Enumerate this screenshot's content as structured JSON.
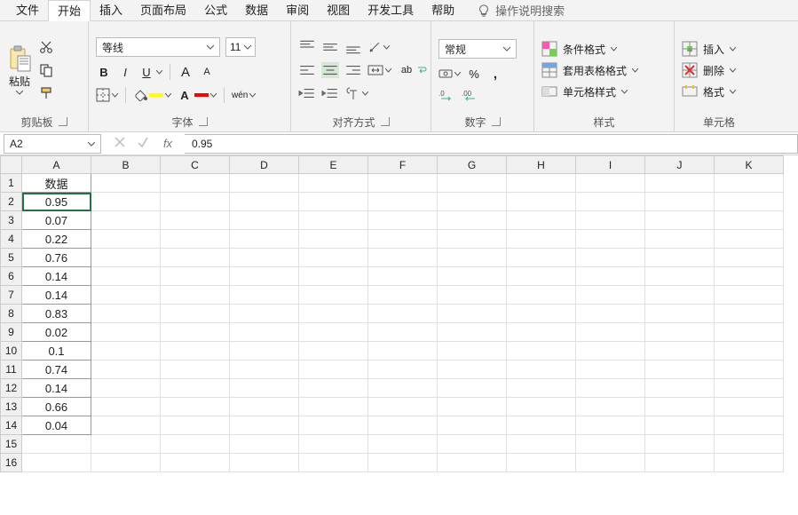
{
  "tabs": {
    "items": [
      "文件",
      "开始",
      "插入",
      "页面布局",
      "公式",
      "数据",
      "审阅",
      "视图",
      "开发工具",
      "帮助"
    ],
    "active_index": 1,
    "tell_me": "操作说明搜索"
  },
  "ribbon": {
    "clipboard": {
      "paste_label": "粘贴",
      "group_label": "剪贴板"
    },
    "font": {
      "name": "等线",
      "size": "11",
      "bold": "B",
      "italic": "I",
      "underline": "U",
      "increase": "A",
      "decrease": "A",
      "phonetic": "wén",
      "fontcolor": "A",
      "group_label": "字体"
    },
    "alignment": {
      "wrap": "ab",
      "group_label": "对齐方式"
    },
    "number": {
      "format": "常规",
      "percent": "%",
      "comma": ",",
      "dec_inc": ".0",
      "dec_dec": ".00",
      "group_label": "数字"
    },
    "styles": {
      "conditional": "条件格式",
      "table": "套用表格格式",
      "cellstyles": "单元格样式",
      "group_label": "样式"
    },
    "cells": {
      "insert": "插入",
      "delete": "删除",
      "format": "格式",
      "group_label": "单元格"
    }
  },
  "formula_bar": {
    "name_box": "A2",
    "fx": "fx",
    "value": "0.95"
  },
  "grid": {
    "columns": [
      "A",
      "B",
      "C",
      "D",
      "E",
      "F",
      "G",
      "H",
      "I",
      "J",
      "K"
    ],
    "row_count": 16,
    "selected_cell": "A2",
    "columnA": {
      "header": "数据",
      "values": [
        "0.95",
        "0.07",
        "0.22",
        "0.76",
        "0.14",
        "0.14",
        "0.83",
        "0.02",
        "0.1",
        "0.74",
        "0.14",
        "0.66",
        "0.04"
      ]
    }
  }
}
